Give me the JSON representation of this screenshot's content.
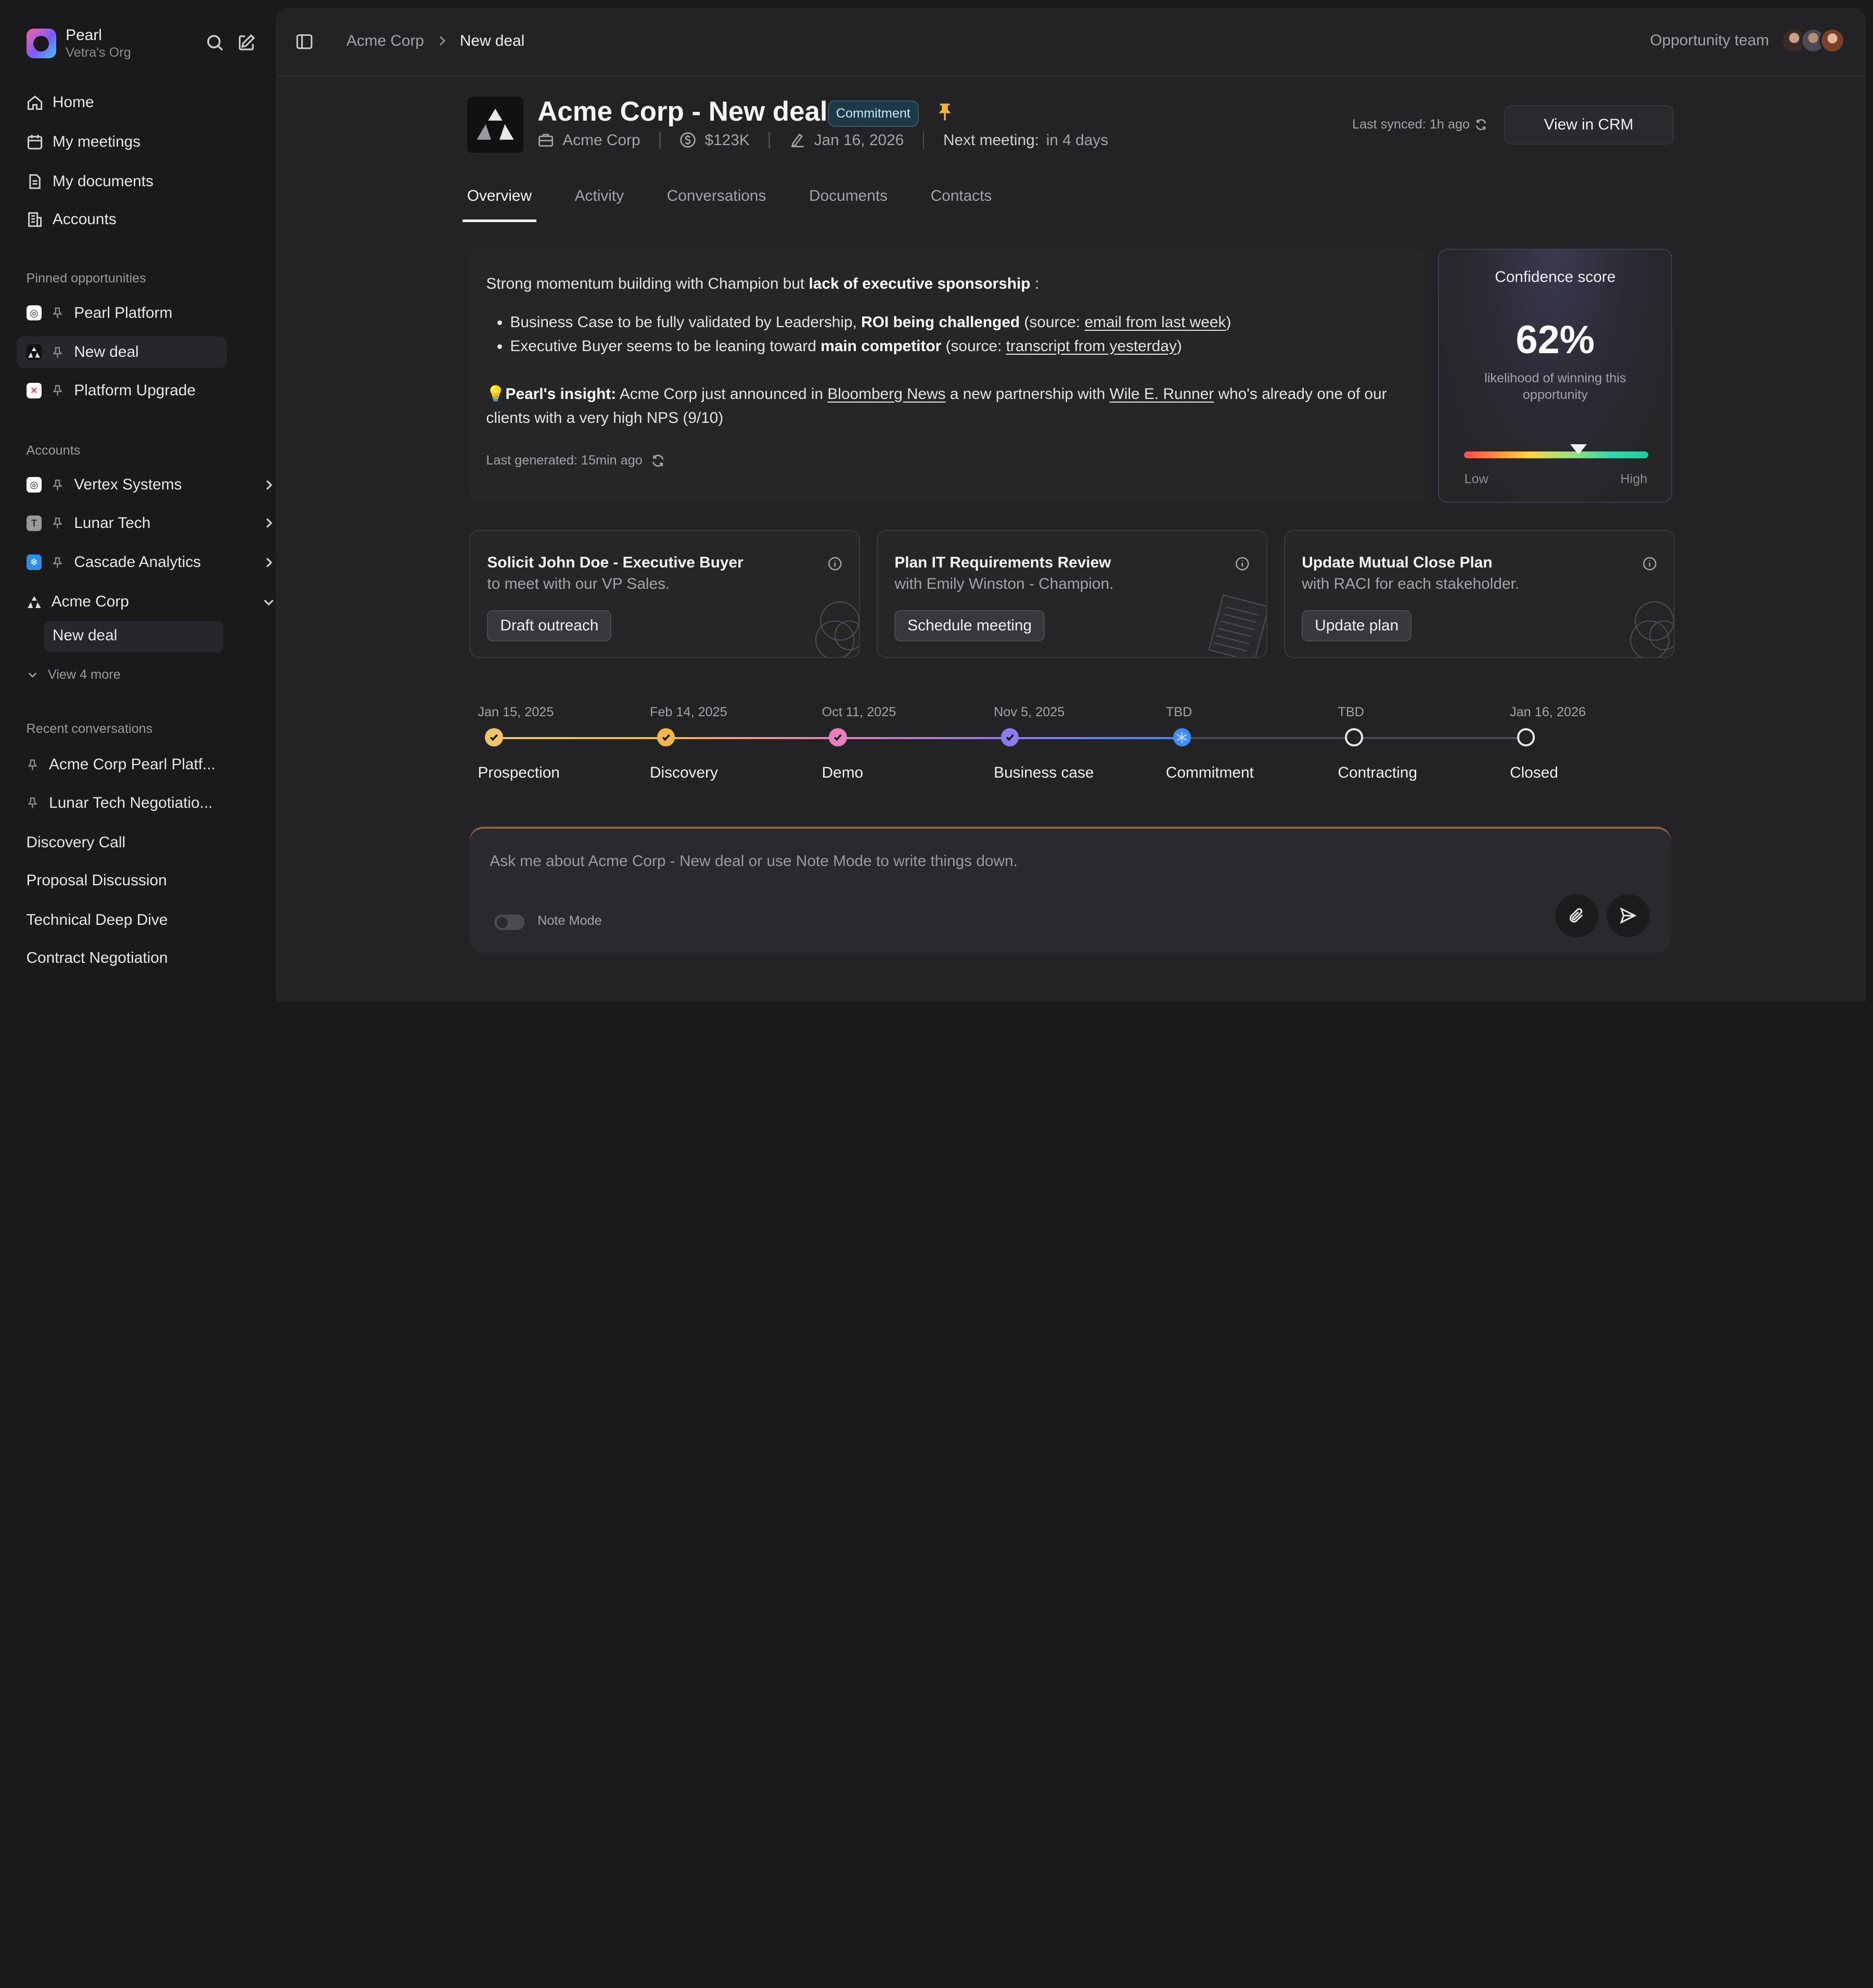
{
  "org": {
    "name": "Pearl",
    "subtitle": "Vetra's Org"
  },
  "nav": [
    {
      "label": "Home",
      "icon": "home-icon"
    },
    {
      "label": "My meetings",
      "icon": "calendar-icon"
    },
    {
      "label": "My documents",
      "icon": "document-icon"
    },
    {
      "label": "Accounts",
      "icon": "building-icon"
    }
  ],
  "pinned": {
    "label": "Pinned opportunities",
    "items": [
      {
        "label": "Pearl Platform"
      },
      {
        "label": "New deal"
      },
      {
        "label": "Platform Upgrade"
      }
    ]
  },
  "accounts": {
    "label": "Accounts",
    "items": [
      {
        "label": "Vertex Systems"
      },
      {
        "label": "Lunar Tech"
      },
      {
        "label": "Cascade Analytics"
      },
      {
        "label": "Acme Corp"
      }
    ],
    "sub_item": "New deal",
    "view_more": "View 4 more"
  },
  "recent": {
    "label": "Recent conversations",
    "items": [
      {
        "label": "Acme Corp Pearl Platf..."
      },
      {
        "label": "Lunar Tech Negotiatio..."
      },
      {
        "label": "Discovery Call"
      },
      {
        "label": "Proposal Discussion"
      },
      {
        "label": "Technical Deep Dive"
      },
      {
        "label": "Contract Negotiation"
      }
    ]
  },
  "breadcrumb": {
    "parent": "Acme Corp",
    "current": "New deal"
  },
  "team": {
    "label": "Opportunity team"
  },
  "deal": {
    "title": "Acme Corp - New deal",
    "stage_badge": "Commitment",
    "company": "Acme Corp",
    "amount": "$123K",
    "close_date": "Jan 16, 2026",
    "next_meeting_label": "Next meeting:",
    "next_meeting": "in 4 days",
    "last_synced": "Last synced: 1h ago",
    "crm_button": "View in CRM"
  },
  "tabs": [
    "Overview",
    "Activity",
    "Conversations",
    "Documents",
    "Contacts"
  ],
  "summary": {
    "intro": "Strong momentum building with Champion but ",
    "intro_bold": "lack of executive sponsorship",
    "intro_end": " :",
    "b1_pre": "Business Case to be fully validated by Leadership, ",
    "b1_bold": "ROI being challenged",
    "b1_mid": " (source: ",
    "b1_link": "email from last week",
    "b1_end": ")",
    "b2_pre": "Executive Buyer seems to be leaning toward ",
    "b2_bold": "main competitor",
    "b2_mid": " (source: ",
    "b2_link": "transcript from yesterday",
    "b2_end": ")",
    "insight_bold": "Pearl's insight:",
    "insight_1": " Acme Corp just announced in ",
    "insight_link1": "Bloomberg News",
    "insight_2": " a new partnership with ",
    "insight_link2": "Wile E. Runner",
    "insight_3": " who's already one of our clients with a very high NPS (9/10)",
    "last_generated": "Last generated: 15min ago"
  },
  "confidence": {
    "title": "Confidence score",
    "value": "62%",
    "fraction": 0.62,
    "description": "likelihood of winning this opportunity",
    "low": "Low",
    "high": "High"
  },
  "cards": [
    {
      "title": "Solicit John Doe - Executive Buyer",
      "subtitle": "to meet with our VP Sales.",
      "button": "Draft outreach"
    },
    {
      "title": "Plan IT Requirements Review",
      "subtitle": "with Emily Winston - Champion.",
      "button": "Schedule meeting"
    },
    {
      "title": "Update Mutual Close Plan",
      "subtitle": "with RACI for each stakeholder.",
      "button": "Update plan"
    }
  ],
  "timeline": [
    {
      "date": "Jan 15, 2025",
      "name": "Prospection",
      "status": "done",
      "color": "#f2c46a"
    },
    {
      "date": "Feb 14, 2025",
      "name": "Discovery",
      "status": "done",
      "color": "#f2b84a"
    },
    {
      "date": "Oct 11, 2025",
      "name": "Demo",
      "status": "done",
      "color": "#e77fbf"
    },
    {
      "date": "Nov 5, 2025",
      "name": "Business case",
      "status": "done",
      "color": "#8d7cf0"
    },
    {
      "date": "TBD",
      "name": "Commitment",
      "status": "current",
      "color": "#3f8cff"
    },
    {
      "date": "TBD",
      "name": "Contracting",
      "status": "todo",
      "color": "#e8e8ea"
    },
    {
      "date": "Jan 16, 2026",
      "name": "Closed",
      "status": "todo",
      "color": "#e8e8ea"
    }
  ],
  "chat": {
    "placeholder": "Ask me about Acme Corp - New deal or use Note Mode to write things down.",
    "note_mode": "Note Mode"
  }
}
